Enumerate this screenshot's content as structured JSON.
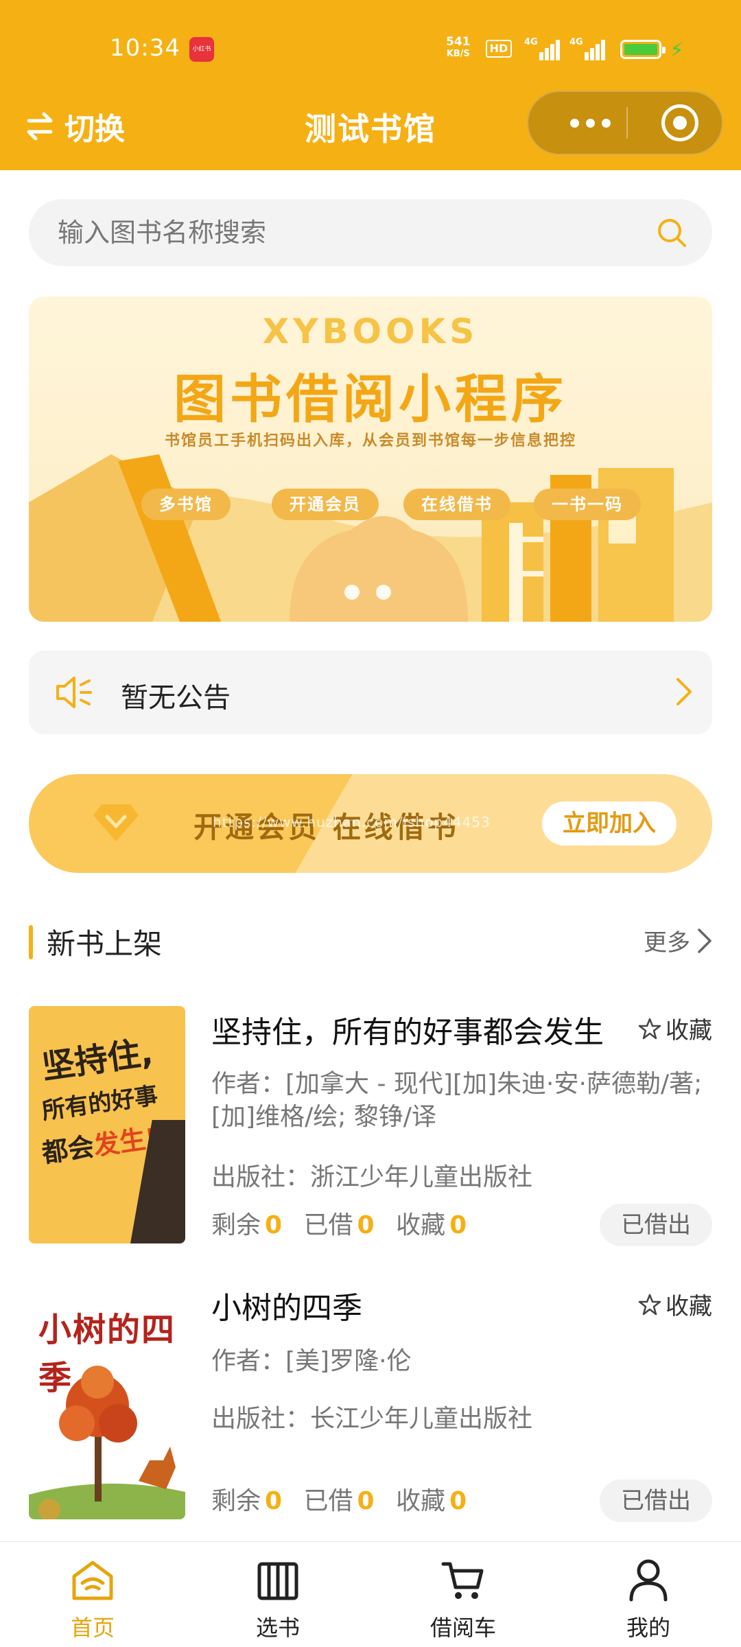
{
  "status_bar": {
    "time": "10:34",
    "app_badge": "小红书",
    "net_speed_value": "541",
    "net_speed_unit": "KB/S",
    "hd_label": "HD",
    "signal_1_label": "4G",
    "signal_2_label": "4G"
  },
  "nav": {
    "switch_label": "切换",
    "title": "测试书馆"
  },
  "search": {
    "placeholder": "输入图书名称搜索"
  },
  "banner": {
    "brand": "XYBOOKS",
    "title": "图书借阅小程序",
    "subtitle": "书馆员工手机扫码出入库，从会员到书馆每一步信息把控",
    "tags": [
      "多书馆",
      "开通会员",
      "在线借书",
      "一书一码"
    ],
    "slide_count": 2
  },
  "notice": {
    "text": "暂无公告"
  },
  "member": {
    "text": "开通会员 在线借书",
    "join_label": "立即加入",
    "watermark": "https://www.huzhan.com/ishop44453"
  },
  "new_books": {
    "section_title": "新书上架",
    "more_label": "更多",
    "items": [
      {
        "title": "坚持住，所有的好事都会发生",
        "favorite_label": "收藏",
        "author": "作者：[加拿大 - 现代][加]朱迪·安·萨德勒/著; [加]维格/绘; 黎铮/译",
        "publisher": "出版社：浙江少年儿童出版社",
        "remaining_label": "剩余",
        "remaining": "0",
        "borrowed_label": "已借",
        "borrowed": "0",
        "favorites_label": "收藏",
        "favorites": "0",
        "status": "已借出",
        "cover_line1": "坚持住,",
        "cover_line2": "所有的好事",
        "cover_line3a": "都会",
        "cover_line3b": "发生!"
      },
      {
        "title": "小树的四季",
        "favorite_label": "收藏",
        "author": "作者：[美]罗隆·伦",
        "publisher": "出版社：长江少年儿童出版社",
        "remaining_label": "剩余",
        "remaining": "0",
        "borrowed_label": "已借",
        "borrowed": "0",
        "favorites_label": "收藏",
        "favorites": "0",
        "status": "已借出",
        "cover_title": "小树的四季"
      }
    ]
  },
  "tabbar": {
    "items": [
      {
        "label": "首页",
        "icon": "home-icon",
        "active": true
      },
      {
        "label": "选书",
        "icon": "books-icon",
        "active": false
      },
      {
        "label": "借阅车",
        "icon": "cart-icon",
        "active": false
      },
      {
        "label": "我的",
        "icon": "user-icon",
        "active": false
      }
    ]
  },
  "colors": {
    "brand": "#F5B014",
    "accent_text": "#E6A50C",
    "number_highlight": "#F5B014"
  }
}
